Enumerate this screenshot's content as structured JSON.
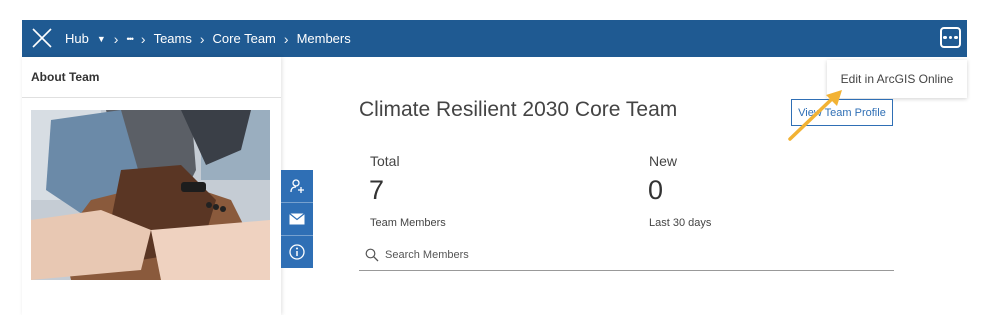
{
  "header": {
    "logo_icon": "close-x-icon",
    "breadcrumbs": {
      "hub": "Hub",
      "ellipsis": "•••",
      "teams": "Teams",
      "core_team": "Core Team",
      "members": "Members"
    },
    "more_icon": "more-options-icon"
  },
  "dropdown": {
    "item": "Edit in ArcGIS Online"
  },
  "sidebar": {
    "title": "About Team",
    "photo_alt": "team-hands-photo"
  },
  "tools": [
    "add-member-icon",
    "mail-icon",
    "info-icon"
  ],
  "main": {
    "title": "Climate Resilient 2030 Core Team",
    "view_profile": "View Team Profile",
    "stats": [
      {
        "label": "Total",
        "value": "7",
        "sub": "Team Members"
      },
      {
        "label": "New",
        "value": "0",
        "sub": "Last 30 days"
      }
    ],
    "search_placeholder": "Search Members"
  },
  "colors": {
    "header": "#1f5a92",
    "accent": "#2f6fb5",
    "arrow": "#f2b233"
  }
}
